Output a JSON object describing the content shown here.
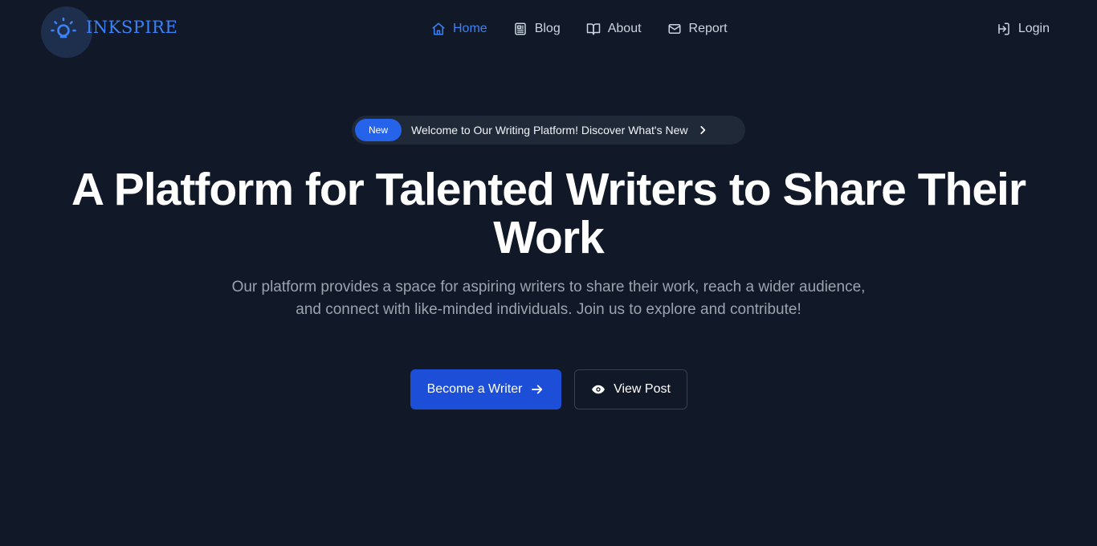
{
  "brand": {
    "name": "INKSPIRE",
    "icon": "lightbulb-icon",
    "accent_color": "#3b82f6"
  },
  "nav": {
    "items": [
      {
        "label": "Home",
        "icon": "home-icon",
        "active": true
      },
      {
        "label": "Blog",
        "icon": "newspaper-icon",
        "active": false
      },
      {
        "label": "About",
        "icon": "book-open-icon",
        "active": false
      },
      {
        "label": "Report",
        "icon": "mail-icon",
        "active": false
      }
    ],
    "login": {
      "label": "Login",
      "icon": "login-icon"
    }
  },
  "hero": {
    "announcement": {
      "badge": "New",
      "text": "Welcome to Our Writing Platform! Discover What's New"
    },
    "title": "A Platform for Talented Writers to Share Their Work",
    "subtitle": "Our platform provides a space for aspiring writers to share their work, reach a wider audience, and connect with like-minded individuals. Join us to explore and contribute!",
    "primary_button": {
      "label": "Become a Writer",
      "icon": "arrow-right-icon",
      "color": "#1d4ed8"
    },
    "secondary_button": {
      "label": "View Post",
      "icon": "eye-icon"
    }
  },
  "colors": {
    "background": "#111827",
    "text_muted": "#9ca3af",
    "nav_text": "#cbd5e1"
  }
}
